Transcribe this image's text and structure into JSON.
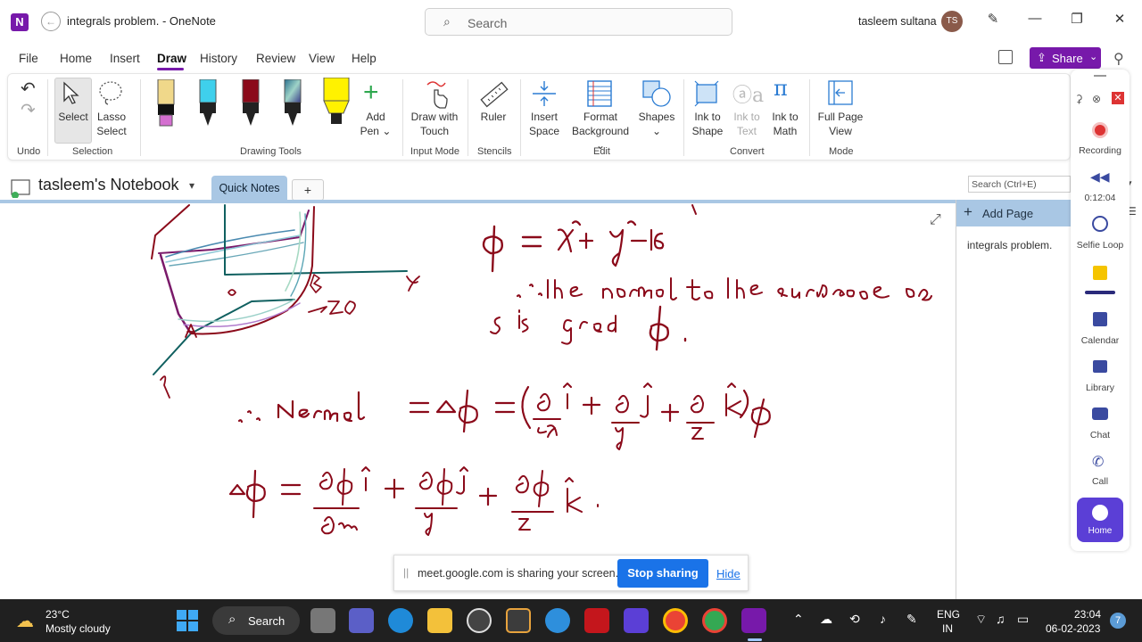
{
  "window": {
    "title": "integrals problem.  - OneNote",
    "search_placeholder": "Search",
    "user_name": "tasleem sultana",
    "user_initials": "TS",
    "accent": "#7719aa"
  },
  "menu": {
    "items": [
      "File",
      "Home",
      "Insert",
      "Draw",
      "History",
      "Review",
      "View",
      "Help"
    ],
    "active": "Draw",
    "share_label": "Share"
  },
  "ribbon": {
    "undo_group": "Undo",
    "select_label": "Select",
    "lasso_label": [
      "Lasso",
      "Select"
    ],
    "selection_group": "Selection",
    "add_pen_label": [
      "Add",
      "Pen"
    ],
    "drawing_tools_group": "Drawing Tools",
    "draw_touch_label": [
      "Draw with",
      "Touch"
    ],
    "input_mode_group": "Input Mode",
    "ruler_label": "Ruler",
    "stencils_group": "Stencils",
    "insert_space_label": [
      "Insert",
      "Space"
    ],
    "format_bg_label": [
      "Format",
      "Background"
    ],
    "shapes_label": "Shapes",
    "edit_group": "Edit",
    "ink_shape_label": [
      "Ink to",
      "Shape"
    ],
    "ink_text_label": [
      "Ink to",
      "Text"
    ],
    "ink_math_label": [
      "Ink to",
      "Math"
    ],
    "convert_group": "Convert",
    "full_page_label": [
      "Full Page",
      "View"
    ],
    "mode_group": "Mode"
  },
  "notebook": {
    "name": "tasleem's Notebook",
    "section_tab": "Quick Notes",
    "add_tab": "+",
    "search_placeholder": "Search (Ctrl+E)",
    "add_page": "Add Page",
    "page_title": "integrals problem."
  },
  "recorder": {
    "recording_label": "Recording",
    "timer": "0:12:04",
    "selfie_label": "Selfie Loop",
    "calendar_label": "Calendar",
    "library_label": "Library",
    "chat_label": "Chat",
    "call_label": "Call",
    "home_label": "Home"
  },
  "screen_share": {
    "message": "meet.google.com is sharing your screen.",
    "stop_label": "Stop sharing",
    "hide_label": "Hide"
  },
  "taskbar": {
    "temperature": "23°C",
    "weather": "Mostly cloudy",
    "search_label": "Search",
    "lang_1": "ENG",
    "lang_2": "IN",
    "time": "23:04",
    "date": "06-02-2023",
    "notification_count": "7"
  },
  "ink_color": "#8b0a1a"
}
